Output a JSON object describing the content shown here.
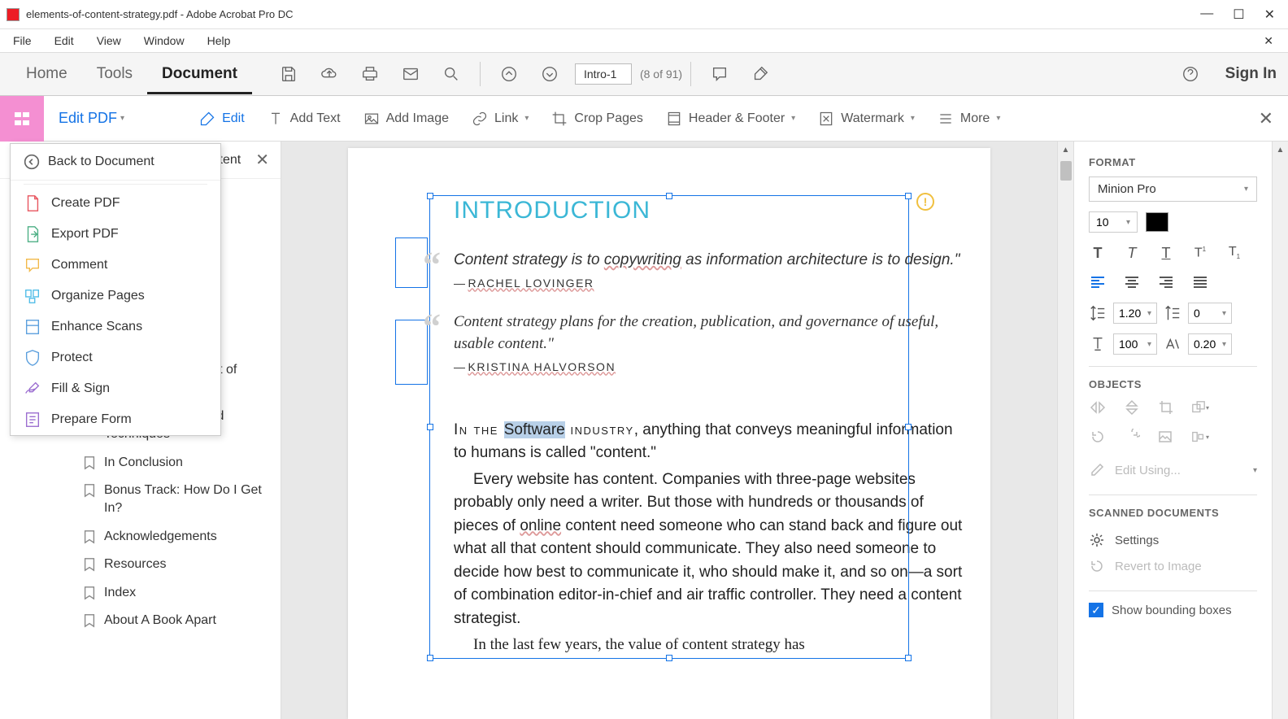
{
  "titlebar": {
    "text": "elements-of-content-strategy.pdf - Adobe Acrobat Pro DC"
  },
  "menubar": {
    "items": [
      "File",
      "Edit",
      "View",
      "Window",
      "Help"
    ]
  },
  "maintoolbar": {
    "tabs": {
      "home": "Home",
      "tools": "Tools",
      "document": "Document"
    },
    "page_field": "Intro-1",
    "page_count": "(8 of 91)",
    "signin": "Sign In"
  },
  "edittoolbar": {
    "editpdf": "Edit PDF",
    "edit": "Edit",
    "addtext": "Add Text",
    "addimage": "Add Image",
    "link": "Link",
    "croppages": "Crop Pages",
    "headerfooter": "Header & Footer",
    "watermark": "Watermark",
    "more": "More"
  },
  "toolsmenu": {
    "back": "Back to Document",
    "items": [
      "Create PDF",
      "Export PDF",
      "Comment",
      "Organize Pages",
      "Enhance Scans",
      "Protect",
      "Fill & Sign",
      "Prepare Form"
    ]
  },
  "sidebar": {
    "visible_partial": "tent",
    "bookmarks": [
      "Chapter 2: The Craft of Content Strategy",
      "Chapter 3: Tools and Techniques",
      "In Conclusion",
      "Bonus Track: How Do I Get In?",
      "Acknowledgements",
      "Resources",
      "Index",
      "About A Book Apart"
    ]
  },
  "document": {
    "heading": "INTRODUCTION",
    "quote1": {
      "text_a": "Content strategy is to ",
      "text_b": "copywriting",
      "text_c": " as information architecture is to design.\"",
      "attr": "RACHEL LOVINGER"
    },
    "quote2": {
      "text": "Content strategy plans for the creation, publication, and governance of useful, usable content.\"",
      "attr": "KRISTINA HALVORSON"
    },
    "para1_a": "In the ",
    "para1_b": "Software",
    "para1_c": " industry",
    "para1_d": ", anything that conveys meaningful information to humans is called \"content.\"",
    "para2_a": "Every website has content. Companies with three-page websites probably only need a writer. But those with hundreds or thousands of pieces of ",
    "para2_b": "online",
    "para2_c": " content need someone who can stand back and figure out what all that content should communicate. They also need someone to decide how best to communicate it, who should make it, and so on—a sort of combination editor-in-chief and air traffic controller. They need a content strategist.",
    "para3": "In the last few years, the value of content strategy has"
  },
  "rightpanel": {
    "format": "FORMAT",
    "font": "Minion Pro",
    "fontsize": "10",
    "lineheight_label": "1.20",
    "letterspacing": "0",
    "scale": "100",
    "kerning": "0.20",
    "objects": "OBJECTS",
    "editusing": "Edit Using...",
    "scanned": "SCANNED DOCUMENTS",
    "settings": "Settings",
    "revert": "Revert to Image",
    "bounding": "Show bounding boxes"
  }
}
